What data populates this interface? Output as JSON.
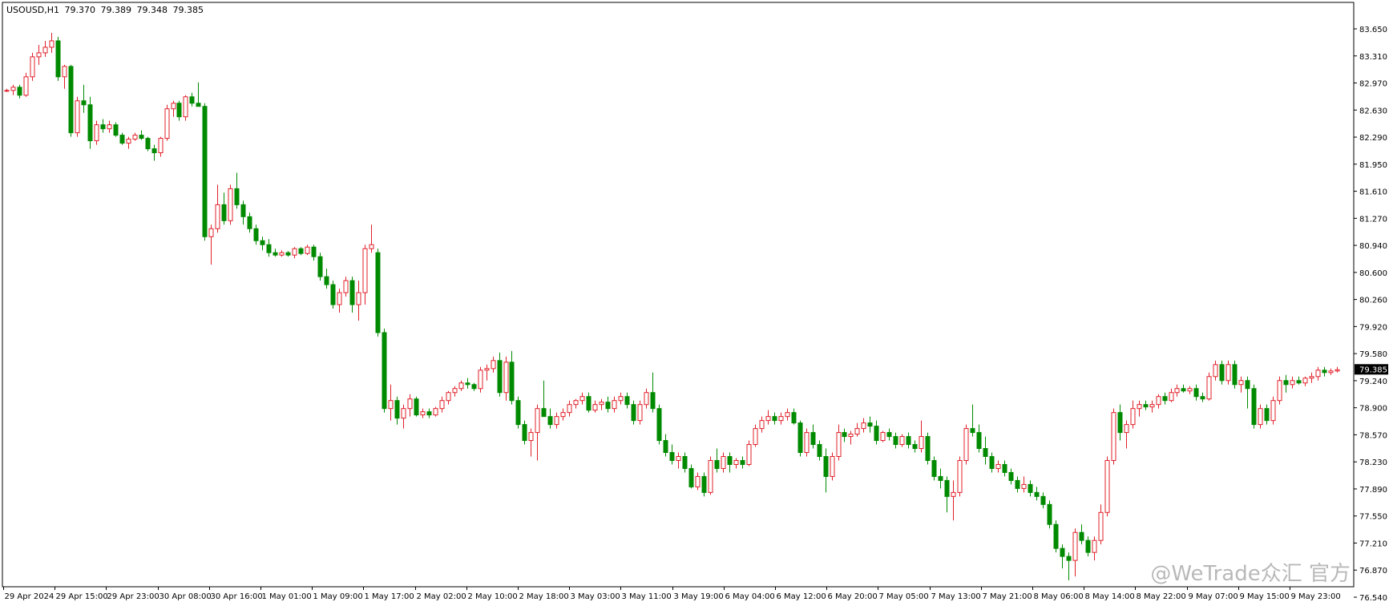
{
  "header": {
    "symbol": "USOUSD,H1",
    "open": "79.370",
    "high": "79.389",
    "low": "79.348",
    "close": "79.385"
  },
  "watermark": "@WeTrade众汇 官方",
  "colors": {
    "bull": "#e0202a",
    "bear": "#008a00",
    "background": "#ffffff",
    "axis": "#000000"
  },
  "chart_data": {
    "type": "candlestick",
    "title": "USOUSD,H1",
    "y_axis": {
      "position": "right",
      "ylim": [
        76.54,
        83.85
      ],
      "ticks": [
        "83.650",
        "83.310",
        "82.970",
        "82.630",
        "82.290",
        "81.950",
        "81.610",
        "81.270",
        "80.940",
        "80.600",
        "80.260",
        "79.920",
        "79.580",
        "79.240",
        "78.900",
        "78.570",
        "78.230",
        "77.890",
        "77.550",
        "77.210",
        "76.870",
        "76.540"
      ],
      "current_price": "79.385"
    },
    "x_axis": {
      "ticks": [
        "29 Apr 2024",
        "29 Apr 15:00",
        "29 Apr 23:00",
        "30 Apr 08:00",
        "30 Apr 16:00",
        "1 May 01:00",
        "1 May 09:00",
        "1 May 17:00",
        "2 May 02:00",
        "2 May 10:00",
        "2 May 18:00",
        "3 May 03:00",
        "3 May 11:00",
        "3 May 19:00",
        "6 May 04:00",
        "6 May 12:00",
        "6 May 20:00",
        "7 May 05:00",
        "7 May 13:00",
        "7 May 21:00",
        "8 May 06:00",
        "8 May 14:00",
        "8 May 22:00",
        "9 May 07:00",
        "9 May 15:00",
        "9 May 23:00"
      ]
    },
    "candles": [
      [
        82.88,
        82.9,
        82.86,
        82.88
      ],
      [
        82.88,
        82.95,
        82.82,
        82.92
      ],
      [
        82.92,
        82.95,
        82.78,
        82.82
      ],
      [
        82.82,
        83.1,
        82.8,
        83.05
      ],
      [
        83.05,
        83.35,
        83.0,
        83.3
      ],
      [
        83.3,
        83.45,
        83.2,
        83.35
      ],
      [
        83.35,
        83.5,
        83.3,
        83.42
      ],
      [
        83.42,
        83.6,
        83.35,
        83.5
      ],
      [
        83.5,
        83.55,
        83.0,
        83.05
      ],
      [
        83.05,
        83.2,
        82.9,
        83.18
      ],
      [
        83.18,
        83.2,
        82.3,
        82.35
      ],
      [
        82.35,
        82.8,
        82.3,
        82.75
      ],
      [
        82.75,
        82.95,
        82.6,
        82.7
      ],
      [
        82.7,
        82.8,
        82.15,
        82.25
      ],
      [
        82.25,
        82.5,
        82.2,
        82.45
      ],
      [
        82.45,
        82.52,
        82.35,
        82.4
      ],
      [
        82.4,
        82.5,
        82.35,
        82.45
      ],
      [
        82.45,
        82.48,
        82.3,
        82.32
      ],
      [
        82.32,
        82.35,
        82.2,
        82.22
      ],
      [
        82.22,
        82.3,
        82.15,
        82.27
      ],
      [
        82.27,
        82.35,
        82.25,
        82.32
      ],
      [
        82.32,
        82.38,
        82.26,
        82.28
      ],
      [
        82.28,
        82.3,
        82.12,
        82.15
      ],
      [
        82.15,
        82.2,
        82.0,
        82.1
      ],
      [
        82.1,
        82.3,
        82.05,
        82.28
      ],
      [
        82.28,
        82.7,
        82.25,
        82.65
      ],
      [
        82.65,
        82.75,
        82.55,
        82.72
      ],
      [
        82.72,
        82.75,
        82.5,
        82.55
      ],
      [
        82.55,
        82.82,
        82.5,
        82.8
      ],
      [
        82.8,
        82.85,
        82.68,
        82.72
      ],
      [
        82.72,
        82.98,
        82.7,
        82.68
      ],
      [
        82.68,
        82.72,
        81.0,
        81.05
      ],
      [
        81.05,
        81.2,
        80.7,
        81.15
      ],
      [
        81.15,
        81.7,
        81.1,
        81.45
      ],
      [
        81.45,
        81.6,
        81.2,
        81.25
      ],
      [
        81.25,
        81.7,
        81.2,
        81.65
      ],
      [
        81.65,
        81.85,
        81.4,
        81.45
      ],
      [
        81.45,
        81.5,
        81.2,
        81.3
      ],
      [
        81.3,
        81.35,
        81.1,
        81.15
      ],
      [
        81.15,
        81.2,
        80.95,
        81.0
      ],
      [
        81.0,
        81.05,
        80.88,
        80.95
      ],
      [
        80.95,
        81.02,
        80.8,
        80.85
      ],
      [
        80.85,
        80.9,
        80.8,
        80.82
      ],
      [
        80.82,
        80.88,
        80.8,
        80.85
      ],
      [
        80.85,
        80.87,
        80.8,
        80.82
      ],
      [
        80.82,
        80.92,
        80.78,
        80.9
      ],
      [
        80.9,
        80.92,
        80.82,
        80.84
      ],
      [
        80.84,
        80.95,
        80.82,
        80.92
      ],
      [
        80.92,
        80.95,
        80.75,
        80.8
      ],
      [
        80.8,
        80.85,
        80.5,
        80.55
      ],
      [
        80.55,
        80.65,
        80.4,
        80.45
      ],
      [
        80.45,
        80.5,
        80.15,
        80.2
      ],
      [
        80.2,
        80.4,
        80.1,
        80.35
      ],
      [
        80.35,
        80.55,
        80.3,
        80.5
      ],
      [
        80.5,
        80.55,
        80.1,
        80.2
      ],
      [
        80.2,
        80.5,
        80.0,
        80.35
      ],
      [
        80.35,
        80.95,
        80.2,
        80.9
      ],
      [
        80.9,
        81.2,
        80.85,
        80.95
      ],
      [
        80.85,
        80.9,
        79.8,
        79.85
      ],
      [
        79.85,
        79.9,
        78.85,
        78.9
      ],
      [
        78.9,
        79.2,
        78.75,
        79.0
      ],
      [
        79.0,
        79.05,
        78.7,
        78.78
      ],
      [
        78.78,
        78.95,
        78.65,
        78.9
      ],
      [
        78.9,
        79.08,
        78.8,
        79.02
      ],
      [
        79.02,
        79.05,
        78.8,
        78.82
      ],
      [
        78.82,
        78.9,
        78.78,
        78.86
      ],
      [
        78.86,
        78.9,
        78.78,
        78.82
      ],
      [
        78.82,
        78.92,
        78.8,
        78.9
      ],
      [
        78.9,
        79.05,
        78.85,
        79.0
      ],
      [
        79.0,
        79.12,
        78.95,
        79.1
      ],
      [
        79.1,
        79.18,
        79.05,
        79.15
      ],
      [
        79.15,
        79.25,
        79.12,
        79.22
      ],
      [
        79.22,
        79.28,
        79.15,
        79.2
      ],
      [
        79.2,
        79.22,
        79.12,
        79.15
      ],
      [
        79.15,
        79.42,
        79.1,
        79.38
      ],
      [
        79.38,
        79.45,
        79.25,
        79.4
      ],
      [
        79.4,
        79.55,
        79.35,
        79.5
      ],
      [
        79.5,
        79.6,
        79.05,
        79.1
      ],
      [
        79.1,
        79.55,
        79.0,
        79.48
      ],
      [
        79.48,
        79.62,
        78.95,
        79.0
      ],
      [
        79.0,
        79.05,
        78.65,
        78.7
      ],
      [
        78.7,
        78.75,
        78.45,
        78.5
      ],
      [
        78.5,
        78.65,
        78.3,
        78.6
      ],
      [
        78.6,
        78.95,
        78.25,
        78.9
      ],
      [
        78.9,
        79.25,
        78.85,
        78.8
      ],
      [
        78.8,
        78.9,
        78.65,
        78.7
      ],
      [
        78.7,
        78.85,
        78.65,
        78.8
      ],
      [
        78.8,
        78.9,
        78.75,
        78.85
      ],
      [
        78.85,
        79.0,
        78.8,
        78.95
      ],
      [
        78.95,
        79.02,
        78.9,
        79.0
      ],
      [
        79.0,
        79.1,
        78.95,
        79.05
      ],
      [
        79.05,
        79.1,
        78.85,
        78.88
      ],
      [
        78.88,
        79.0,
        78.85,
        78.95
      ],
      [
        78.95,
        79.02,
        78.88,
        78.98
      ],
      [
        78.98,
        79.05,
        78.85,
        78.9
      ],
      [
        78.9,
        79.05,
        78.85,
        79.0
      ],
      [
        79.0,
        79.1,
        78.95,
        79.05
      ],
      [
        79.05,
        79.1,
        78.9,
        78.95
      ],
      [
        78.95,
        79.0,
        78.7,
        78.75
      ],
      [
        78.75,
        79.0,
        78.7,
        78.95
      ],
      [
        78.95,
        79.15,
        78.9,
        79.1
      ],
      [
        79.1,
        79.35,
        78.85,
        78.9
      ],
      [
        78.9,
        78.95,
        78.45,
        78.5
      ],
      [
        78.5,
        78.58,
        78.3,
        78.35
      ],
      [
        78.35,
        78.45,
        78.2,
        78.25
      ],
      [
        78.25,
        78.35,
        78.15,
        78.3
      ],
      [
        78.3,
        78.35,
        78.1,
        78.15
      ],
      [
        78.15,
        78.2,
        77.9,
        77.92
      ],
      [
        77.92,
        78.1,
        77.88,
        78.05
      ],
      [
        78.05,
        78.1,
        77.8,
        77.85
      ],
      [
        77.85,
        78.3,
        77.82,
        78.25
      ],
      [
        78.25,
        78.4,
        78.1,
        78.15
      ],
      [
        78.15,
        78.35,
        78.1,
        78.3
      ],
      [
        78.3,
        78.35,
        78.1,
        78.2
      ],
      [
        78.2,
        78.28,
        78.15,
        78.25
      ],
      [
        78.25,
        78.3,
        78.15,
        78.2
      ],
      [
        78.2,
        78.5,
        78.18,
        78.45
      ],
      [
        78.45,
        78.7,
        78.42,
        78.65
      ],
      [
        78.65,
        78.8,
        78.6,
        78.75
      ],
      [
        78.75,
        78.88,
        78.7,
        78.8
      ],
      [
        78.8,
        78.85,
        78.7,
        78.75
      ],
      [
        78.75,
        78.85,
        78.7,
        78.8
      ],
      [
        78.8,
        78.9,
        78.75,
        78.85
      ],
      [
        78.85,
        78.9,
        78.7,
        78.72
      ],
      [
        78.72,
        78.75,
        78.3,
        78.35
      ],
      [
        78.35,
        78.65,
        78.3,
        78.6
      ],
      [
        78.6,
        78.7,
        78.4,
        78.45
      ],
      [
        78.45,
        78.5,
        78.25,
        78.3
      ],
      [
        78.3,
        78.4,
        77.85,
        78.05
      ],
      [
        78.05,
        78.35,
        78.0,
        78.3
      ],
      [
        78.3,
        78.7,
        78.25,
        78.6
      ],
      [
        78.6,
        78.65,
        78.48,
        78.55
      ],
      [
        78.55,
        78.62,
        78.45,
        78.58
      ],
      [
        78.58,
        78.72,
        78.55,
        78.65
      ],
      [
        78.65,
        78.78,
        78.6,
        78.72
      ],
      [
        78.72,
        78.8,
        78.6,
        78.68
      ],
      [
        78.68,
        78.75,
        78.45,
        78.5
      ],
      [
        78.5,
        78.62,
        78.48,
        78.6
      ],
      [
        78.6,
        78.65,
        78.5,
        78.55
      ],
      [
        78.55,
        78.6,
        78.4,
        78.45
      ],
      [
        78.45,
        78.58,
        78.42,
        78.55
      ],
      [
        78.55,
        78.6,
        78.4,
        78.45
      ],
      [
        78.45,
        78.5,
        78.35,
        78.4
      ],
      [
        78.4,
        78.75,
        78.35,
        78.55
      ],
      [
        78.55,
        78.6,
        78.2,
        78.25
      ],
      [
        78.25,
        78.3,
        78.0,
        78.05
      ],
      [
        78.05,
        78.15,
        77.9,
        78.0
      ],
      [
        78.0,
        78.05,
        77.6,
        77.8
      ],
      [
        77.8,
        78.0,
        77.5,
        77.85
      ],
      [
        77.85,
        78.3,
        77.8,
        78.25
      ],
      [
        78.25,
        78.7,
        78.2,
        78.65
      ],
      [
        78.65,
        78.95,
        78.55,
        78.6
      ],
      [
        78.6,
        78.7,
        78.35,
        78.4
      ],
      [
        78.4,
        78.55,
        78.2,
        78.3
      ],
      [
        78.3,
        78.35,
        78.1,
        78.15
      ],
      [
        78.15,
        78.25,
        78.1,
        78.2
      ],
      [
        78.2,
        78.25,
        78.05,
        78.1
      ],
      [
        78.1,
        78.15,
        77.95,
        78.0
      ],
      [
        78.0,
        78.05,
        77.85,
        77.9
      ],
      [
        77.9,
        78.05,
        77.85,
        77.95
      ],
      [
        77.95,
        78.0,
        77.8,
        77.85
      ],
      [
        77.85,
        77.92,
        77.75,
        77.8
      ],
      [
        77.8,
        77.85,
        77.65,
        77.7
      ],
      [
        77.7,
        77.75,
        77.4,
        77.45
      ],
      [
        77.45,
        77.5,
        77.1,
        77.15
      ],
      [
        77.15,
        77.2,
        76.9,
        77.05
      ],
      [
        77.05,
        77.1,
        76.75,
        77.0
      ],
      [
        77.0,
        77.4,
        76.8,
        77.35
      ],
      [
        77.35,
        77.45,
        77.2,
        77.25
      ],
      [
        77.25,
        77.3,
        77.05,
        77.1
      ],
      [
        77.1,
        77.3,
        77.0,
        77.25
      ],
      [
        77.25,
        77.7,
        77.2,
        77.6
      ],
      [
        77.6,
        78.3,
        77.55,
        78.25
      ],
      [
        78.25,
        78.9,
        78.2,
        78.85
      ],
      [
        78.85,
        78.95,
        78.5,
        78.6
      ],
      [
        78.6,
        78.75,
        78.4,
        78.7
      ],
      [
        78.7,
        79.0,
        78.65,
        78.9
      ],
      [
        78.9,
        79.0,
        78.8,
        78.95
      ],
      [
        78.95,
        79.0,
        78.88,
        78.92
      ],
      [
        78.92,
        79.0,
        78.85,
        78.95
      ],
      [
        78.95,
        79.08,
        78.9,
        79.05
      ],
      [
        79.05,
        79.1,
        78.95,
        79.0
      ],
      [
        79.0,
        79.15,
        78.98,
        79.1
      ],
      [
        79.1,
        79.2,
        79.05,
        79.15
      ],
      [
        79.15,
        79.2,
        79.1,
        79.12
      ],
      [
        79.12,
        79.18,
        79.08,
        79.15
      ],
      [
        79.15,
        79.2,
        79.0,
        79.05
      ],
      [
        79.05,
        79.1,
        78.98,
        79.02
      ],
      [
        79.02,
        79.35,
        79.0,
        79.3
      ],
      [
        79.3,
        79.5,
        79.25,
        79.45
      ],
      [
        79.45,
        79.5,
        79.2,
        79.25
      ],
      [
        79.25,
        79.5,
        79.2,
        79.45
      ],
      [
        79.45,
        79.5,
        79.15,
        79.2
      ],
      [
        79.2,
        79.3,
        79.1,
        79.25
      ],
      [
        79.25,
        79.3,
        78.9,
        79.15
      ],
      [
        79.15,
        79.2,
        78.65,
        78.7
      ],
      [
        78.7,
        78.95,
        78.65,
        78.9
      ],
      [
        78.9,
        78.95,
        78.7,
        78.75
      ],
      [
        78.75,
        79.05,
        78.7,
        79.0
      ],
      [
        79.0,
        79.3,
        78.95,
        79.25
      ],
      [
        79.25,
        79.32,
        79.1,
        79.2
      ],
      [
        79.2,
        79.3,
        79.15,
        79.25
      ],
      [
        79.25,
        79.3,
        79.2,
        79.22
      ],
      [
        79.22,
        79.3,
        79.18,
        79.28
      ],
      [
        79.28,
        79.35,
        79.22,
        79.3
      ],
      [
        79.3,
        79.42,
        79.25,
        79.38
      ],
      [
        79.38,
        79.42,
        79.3,
        79.35
      ],
      [
        79.35,
        79.4,
        79.32,
        79.37
      ],
      [
        79.37,
        79.42,
        79.35,
        79.385
      ]
    ]
  }
}
